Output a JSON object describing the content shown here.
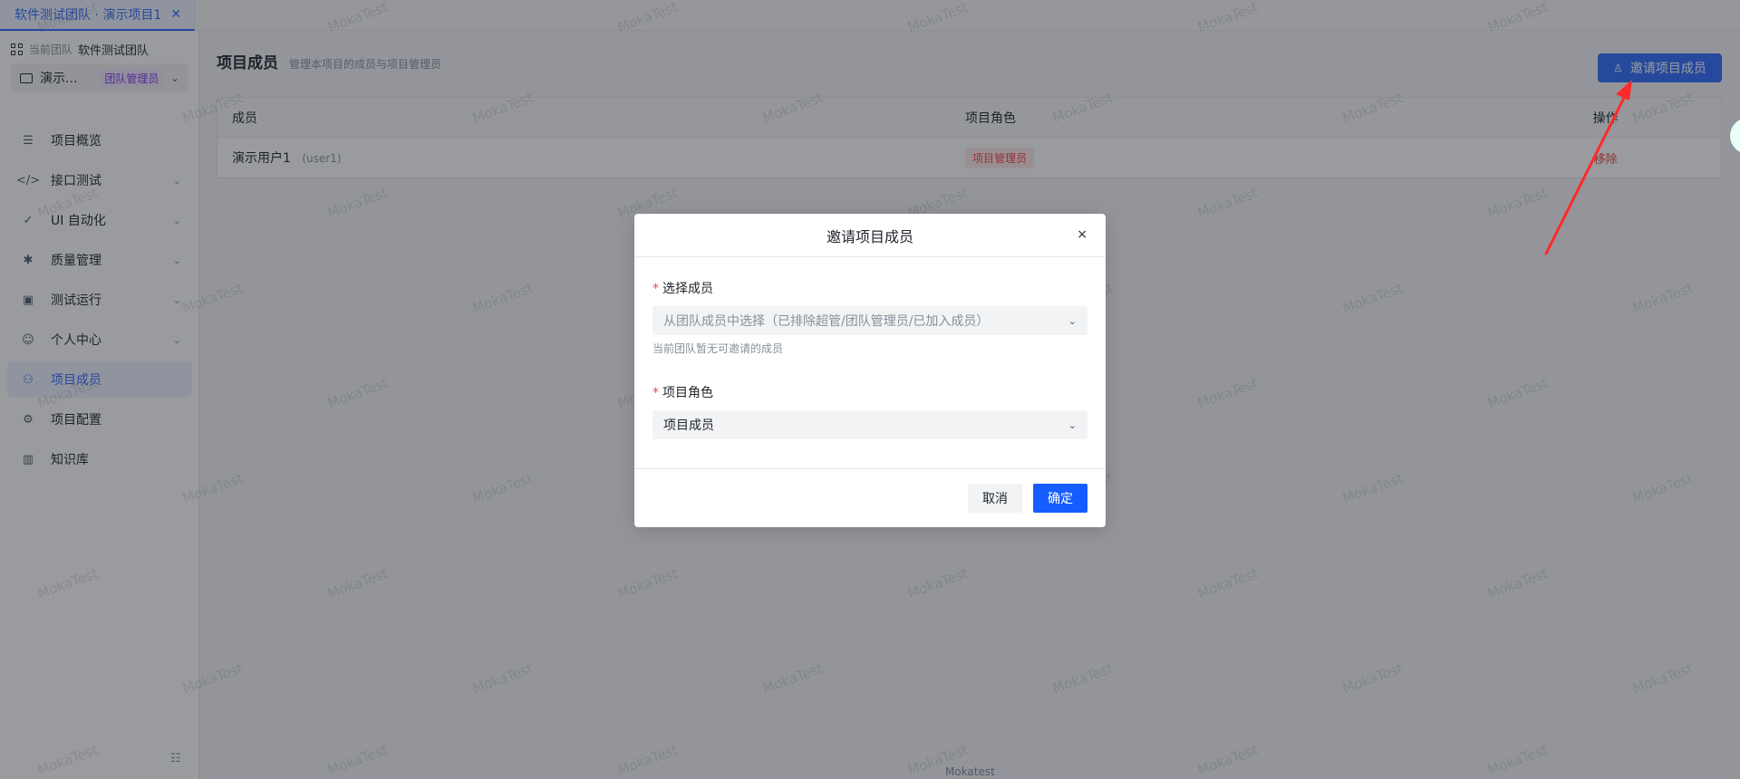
{
  "tab": {
    "label": "软件测试团队 · 演示项目1",
    "close_glyph": "✕"
  },
  "sidebar": {
    "team_prefix": "当前团队",
    "team_name": "软件测试团队",
    "project_name": "演示...",
    "project_badge": "团队管理员",
    "items": [
      {
        "label": "项目概览",
        "icon": "list-icon",
        "has_children": false,
        "active": false
      },
      {
        "label": "接口测试",
        "icon": "code-icon",
        "has_children": true,
        "active": false
      },
      {
        "label": "UI 自动化",
        "icon": "check-circle-icon",
        "has_children": true,
        "active": false
      },
      {
        "label": "质量管理",
        "icon": "bug-icon",
        "has_children": true,
        "active": false
      },
      {
        "label": "测试运行",
        "icon": "run-icon",
        "has_children": true,
        "active": false
      },
      {
        "label": "个人中心",
        "icon": "user-icon",
        "has_children": true,
        "active": false
      },
      {
        "label": "项目成员",
        "icon": "team-icon",
        "has_children": false,
        "active": true
      },
      {
        "label": "项目配置",
        "icon": "gear-icon",
        "has_children": false,
        "active": false
      },
      {
        "label": "知识库",
        "icon": "book-icon",
        "has_children": false,
        "active": false
      }
    ]
  },
  "main": {
    "title": "项目成员",
    "subtitle": "管理本项目的成员与项目管理员",
    "invite_label": "邀请项目成员",
    "table": {
      "headers": [
        "成员",
        "项目角色",
        "操作"
      ],
      "rows": [
        {
          "name": "演示用户1",
          "id": "(user1)",
          "role": "项目管理员",
          "action": "移除"
        }
      ]
    }
  },
  "modal": {
    "title": "邀请项目成员",
    "close_glyph": "×",
    "member_label": "选择成员",
    "member_placeholder": "从团队成员中选择（已排除超管/团队管理员/已加入成员）",
    "member_help": "当前团队暂无可邀请的成员",
    "role_label": "项目角色",
    "role_value": "项目成员",
    "cancel_label": "取消",
    "ok_label": "确定"
  },
  "watermark": "MokaTest",
  "footer_mark": "Mokatest",
  "colors": {
    "accent": "#2f6bff",
    "primary_button": "#165dff",
    "danger": "#f53f3f",
    "annotation_arrow": "#ff2a2a"
  }
}
